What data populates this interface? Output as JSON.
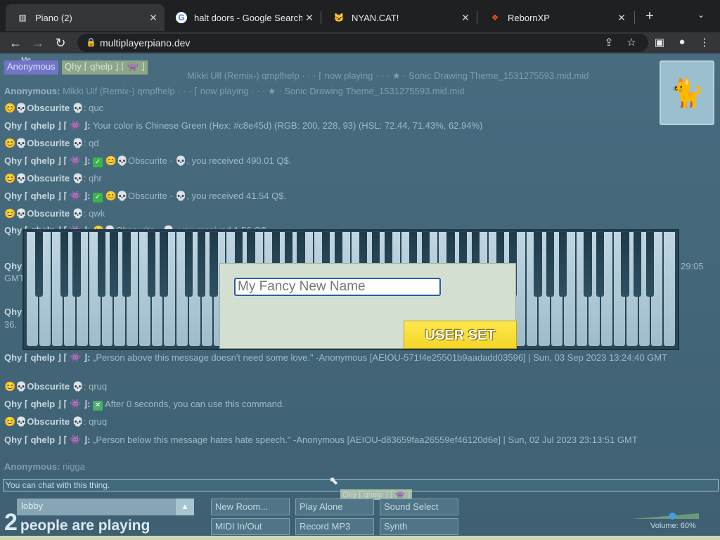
{
  "browser": {
    "tabs": [
      {
        "title": "Piano (2)",
        "icon": "piano-favicon",
        "active": true
      },
      {
        "title": "halt doors - Google Search",
        "icon": "google-favicon",
        "active": false
      },
      {
        "title": "NYAN.CAT!",
        "icon": "cat-favicon",
        "active": false
      },
      {
        "title": "RebornXP",
        "icon": "windows-favicon",
        "active": false
      }
    ],
    "url": "multiplayerpiano.dev"
  },
  "badges": {
    "me": "Me",
    "self_name": "Anonymous",
    "other_name": "Qhy ⌈ qhelp ⌋ ⌈ 👾 ⌋"
  },
  "chat": {
    "lines": [
      {
        "name": "Anonymous:",
        "text": "Mikki Ulf (Remix-) qmpfhelp · · · ⌈ now playing · · · ★ · Sonic Drawing Theme_1531275593.mid.mid"
      },
      {
        "name": "Anonymous:",
        "text": "Mikki Ulf (Remix-) qmpfhelp · · · ⌈ now playing · · · ★ · Sonic Drawing Theme_1531275593.mid.mid"
      },
      {
        "name": "😊💀Obscurite",
        "text": "💀: quc"
      },
      {
        "name": "Qhy ⌈ qhelp ⌋ ⌈ 👾 ⌋:",
        "text": "Your color is Chinese Green (Hex: #c8e45d) (RGB: 200, 228, 93) (HSL: 72.44, 71.43%, 62.94%)"
      },
      {
        "name": "😊💀Obscurite",
        "text": "💀: qd"
      },
      {
        "name": "Qhy ⌈ qhelp ⌋ ⌈ 👾 ⌋:",
        "text": "😊💀Obscurite · 💀, you received 490.01 Q$."
      },
      {
        "name": "😊💀Obscurite",
        "text": "💀: qhr"
      },
      {
        "name": "Qhy ⌈ qhelp ⌋ ⌈ 👾 ⌋:",
        "text": "😊💀Obscurite · 💀, you received 41.54 Q$."
      },
      {
        "name": "😊💀Obscurite",
        "text": "💀: qwk"
      },
      {
        "name": "Qhy ⌈ qhelp ⌋ ⌈ 👾 ⌋:",
        "text": "😊💀Obscurite · 💀, you received 1.56 Q$."
      },
      {
        "name": "Qhy ⌈ qhelp ⌋ ⌈ 👾 ⌋:",
        "text": "„Person above this message doesn't need some love.\" -Anonymous [AEIOU-571f4e25501b9aadadd03596] | Sun, 03 Sep 2023 13:24:40 GMT"
      },
      {
        "name": "😊💀Obscurite",
        "text": "💀: qruq"
      },
      {
        "name": "Qhy ⌈ qhelp ⌋ ⌈ 👾 ⌋:",
        "text": "After 0 seconds, you can use this command."
      },
      {
        "name": "😊💀Obscurite",
        "text": "💀: qruq"
      },
      {
        "name": "Qhy ⌈ qhelp ⌋ ⌈ 👾 ⌋:",
        "text": "„Person below this message hates hate speech.\" -Anonymous [AEIOU-d83659faa26559ef46120d6e] | Sun, 02 Jul 2023 23:13:51 GMT"
      },
      {
        "name": "Anonymous:",
        "text": "nigga"
      }
    ],
    "partial": {
      "left_a": "Qhy",
      "left_b": "GMT",
      "left_c": "Qhy",
      "left_d": "36.",
      "right_time": "29:05"
    },
    "input_placeholder": "You can chat with this thing."
  },
  "modal": {
    "name_value": "My Fancy New Name",
    "button_label": "USER SET"
  },
  "bottom": {
    "room": "lobby",
    "people_count": "2",
    "people_text": "people are playing",
    "buttons": {
      "new_room": "New Room...",
      "play_alone": "Play Alone",
      "sound_select": "Sound Select",
      "midi": "MIDI In/Out",
      "record": "Record MP3",
      "synth": "Synth"
    },
    "volume_label": "Volume: 60%",
    "volume_level": 0.6,
    "tooltip": "Qhy ⌈ qhelp ⌋ ⌈ 👾 ⌋"
  },
  "colors": {
    "background": "#486c7f",
    "piano_bg": "#294656",
    "modal_bg": "#d3dfd0",
    "userset_button": "#ffe84d",
    "self_badge": "#7374c8"
  }
}
